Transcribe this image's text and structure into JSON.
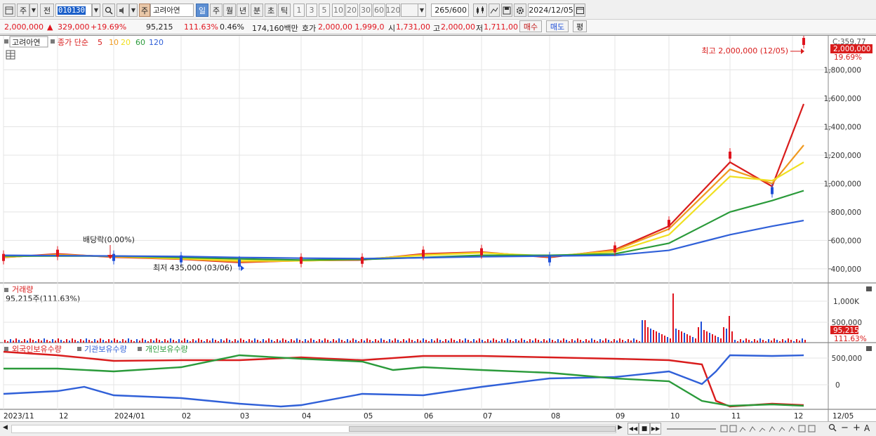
{
  "toolbar": {
    "market_type": "주",
    "prev_label": "전",
    "stock_code": "010130",
    "stock_type_badge": "주",
    "stock_name": "고려아연",
    "periods": [
      "일",
      "주",
      "월",
      "년",
      "분",
      "초",
      "틱"
    ],
    "selected_period": "일",
    "intervals": [
      "1",
      "3",
      "5",
      "10",
      "20",
      "30",
      "60",
      "120"
    ],
    "count_current": "265",
    "count_total": "/600",
    "date": "2024/12/05"
  },
  "quote": {
    "price": "2,000,000",
    "change_arrow": "▲",
    "change": "329,000",
    "change_pct": "+19.69%",
    "volume": "95,215",
    "volume_ratio": "111.63%",
    "turnover": "0.46%",
    "amount": "174,160백만",
    "bid_label": "호가",
    "bid_values": "2,000,00  1,999,0",
    "open_label": "시",
    "open": "1,731,00",
    "high_label": "고",
    "high": "2,000,00",
    "low_label": "저",
    "low": "1,711,00",
    "buy_label": "매수",
    "sell_label": "매도",
    "eval_label": "평"
  },
  "price_panel": {
    "legend_stock": "고려아연",
    "legend_ma_prefix": "종가 단순",
    "ma_periods": [
      "5",
      "10",
      "20",
      "60",
      "120"
    ],
    "ma_colors": [
      "#d91c1c",
      "#f09a20",
      "#f0e020",
      "#2a9a3a",
      "#3060d8"
    ],
    "y_ticks": [
      "1,800,000",
      "1,600,000",
      "1,400,000",
      "1,200,000",
      "1,000,000",
      "800,000",
      "600,000",
      "400,000"
    ],
    "current_label": "C:359.77",
    "current_price_tag": "2,000,000",
    "current_pct_tag": "19.69%",
    "high_annotation": "최고 2,000,000 (12/05)",
    "low_annotation": "최저 435,000 (03/06)",
    "dividend_annotation": "배당락(0.00%)"
  },
  "volume_panel": {
    "title": "거래량",
    "value_label": "95,215주(111.63%)",
    "y_ticks": [
      "1,000K",
      "500,000"
    ],
    "tag_value": "95,215",
    "tag_pct": "111.63%"
  },
  "holding_panel": {
    "legends": [
      "외국인보유수량",
      "기관보유수량",
      "개인보유수량"
    ],
    "legend_colors": [
      "#d91c1c",
      "#3060d8",
      "#2a9a3a"
    ],
    "y_ticks": [
      "500,000",
      "0"
    ]
  },
  "x_axis": [
    "2023/11",
    "12",
    "2024/01",
    "02",
    "03",
    "04",
    "05",
    "06",
    "07",
    "08",
    "09",
    "10",
    "11",
    "12",
    "12/05"
  ],
  "chart_data": {
    "type": "line",
    "title": "",
    "ylabel": "",
    "ylim": [
      350000,
      2000000
    ],
    "x": [
      "2023/11",
      "12",
      "2024/01",
      "02",
      "03",
      "04",
      "05",
      "06",
      "07",
      "08",
      "09",
      "10",
      "11",
      "12",
      "12/05"
    ],
    "series": [
      {
        "name": "종가",
        "values": [
          480000,
          510000,
          480000,
          470000,
          440000,
          460000,
          460000,
          510000,
          520000,
          470000,
          540000,
          720000,
          1200000,
          950000,
          2000000
        ]
      },
      {
        "name": "5",
        "values": [
          480000,
          505000,
          482000,
          468000,
          445000,
          458000,
          462000,
          505000,
          518000,
          480000,
          535000,
          700000,
          1150000,
          980000,
          1560000
        ]
      },
      {
        "name": "10",
        "values": [
          482000,
          500000,
          485000,
          470000,
          450000,
          457000,
          465000,
          500000,
          515000,
          485000,
          530000,
          680000,
          1100000,
          1000000,
          1270000
        ]
      },
      {
        "name": "20",
        "values": [
          485000,
          495000,
          488000,
          472000,
          458000,
          456000,
          468000,
          495000,
          512000,
          490000,
          520000,
          640000,
          1050000,
          1020000,
          1150000
        ]
      },
      {
        "name": "60",
        "values": [
          490000,
          490000,
          490000,
          480000,
          470000,
          462000,
          466000,
          480000,
          495000,
          495000,
          505000,
          580000,
          800000,
          880000,
          950000
        ]
      },
      {
        "name": "120",
        "values": [
          495000,
          493000,
          490000,
          487000,
          480000,
          475000,
          472000,
          478000,
          485000,
          490000,
          495000,
          530000,
          640000,
          700000,
          740000
        ]
      }
    ]
  },
  "bottom": {
    "scroll_left": "◀",
    "scroll_right": "▶",
    "nav_buttons": [
      "|◀◀",
      "■",
      "▶▶|"
    ],
    "zoom_out": "−",
    "zoom_in": "+",
    "font_btn": "A"
  }
}
